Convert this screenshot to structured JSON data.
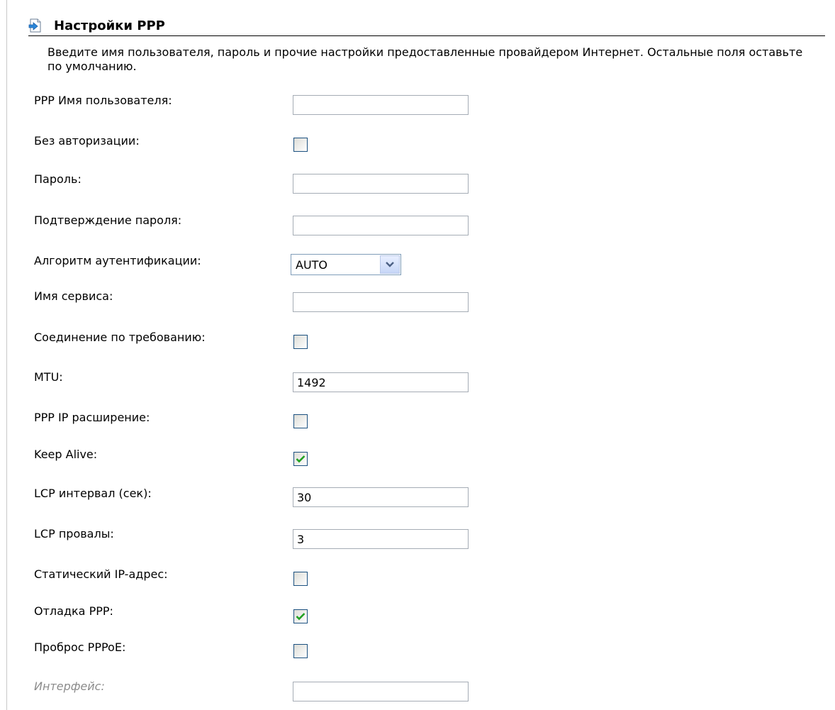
{
  "header": {
    "title": "Настройки PPP",
    "icon": "arrow-page-icon"
  },
  "description": "Введите имя пользователя, пароль и прочие настройки предоставленные провайдером Интернет. Остальные поля оставьте по умолчанию.",
  "fields": {
    "ppp_username": {
      "label": "PPP Имя пользователя:",
      "value": ""
    },
    "no_auth": {
      "label": "Без авторизации:",
      "checked": false
    },
    "password": {
      "label": "Пароль:",
      "value": ""
    },
    "password_confirm": {
      "label": "Подтверждение пароля:",
      "value": ""
    },
    "auth_algorithm": {
      "label": "Алгоритм аутентификации:",
      "selected": "AUTO"
    },
    "service_name": {
      "label": "Имя сервиса:",
      "value": ""
    },
    "dial_on_demand": {
      "label": "Соединение по требованию:",
      "checked": false
    },
    "mtu": {
      "label": "MTU:",
      "value": "1492"
    },
    "ppp_ip_extension": {
      "label": "PPP IP расширение:",
      "checked": false
    },
    "keep_alive": {
      "label": "Keep Alive:",
      "checked": true
    },
    "lcp_interval": {
      "label": "LCP интервал (сек):",
      "value": "30"
    },
    "lcp_failures": {
      "label": "LCP провалы:",
      "value": "3"
    },
    "static_ip": {
      "label": "Статический IP-адрес:",
      "checked": false
    },
    "ppp_debug": {
      "label": "Отладка PPP:",
      "checked": true
    },
    "pppoe_passthrough": {
      "label": "Проброс PPPoE:",
      "checked": false
    },
    "interface": {
      "label": "Интерфейс:",
      "value": "",
      "disabled": true
    }
  },
  "colors": {
    "check_mark": "#21a121",
    "checkbox_border": "#1c5180",
    "input_border": "#a5acb5",
    "disabled_label": "#8c8c8c"
  }
}
